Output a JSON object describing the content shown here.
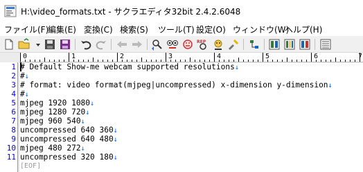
{
  "window": {
    "title": "H:\\video_formats.txt - サクラエディタ32bit 2.4.2.6048"
  },
  "menu": [
    "ファイル(F)",
    "編集(E)",
    "変換(C)",
    "検索(S)",
    "ツール(T)",
    "設定(O)",
    "ウィンドウ(W)",
    "ヘルプ(H)"
  ],
  "toolbar": {
    "icons": [
      "new-file-icon",
      "open-folder-icon",
      "open-dropdown-icon",
      "save-icon",
      "save-all-icon",
      "undo-icon",
      "redo-icon",
      "jump-back-icon",
      "jump-forward-icon",
      "search-prev-icon",
      "search-next-icon",
      "search-prev-red-icon",
      "grep-icon",
      "bookmark-icon",
      "replace-icon",
      "compare-icon",
      "macro-icon",
      "outline-icon",
      "settings-icon",
      "font-icon"
    ]
  },
  "ruler": {
    "labels": [
      "0",
      "1",
      "2",
      "3",
      "4",
      "5",
      "6",
      "7"
    ]
  },
  "editor": {
    "lines": [
      {
        "num": "1",
        "text": "# Default Show-me webcam supported resolutions",
        "newline": "↓"
      },
      {
        "num": "2",
        "text": "#",
        "newline": "↓"
      },
      {
        "num": "3",
        "text": "# format: video format(mjpeg|uncompressed) x-dimension y-dimension",
        "newline": "↓"
      },
      {
        "num": "4",
        "text": "#",
        "newline": "↓"
      },
      {
        "num": "5",
        "text": "mjpeg 1920 1080",
        "newline": "↓"
      },
      {
        "num": "6",
        "text": "mjpeg 1280 720",
        "newline": "↓"
      },
      {
        "num": "7",
        "text": "mjpeg 960 540",
        "newline": "↓"
      },
      {
        "num": "8",
        "text": "uncompressed 640 360",
        "newline": "↓"
      },
      {
        "num": "9",
        "text": "uncompressed 640 480",
        "newline": "↓"
      },
      {
        "num": "10",
        "text": "mjpeg 480 272",
        "newline": "↓"
      },
      {
        "num": "11",
        "text": "uncompressed 320 180",
        "newline": "↓"
      }
    ],
    "eof_label": "[EOF]"
  },
  "colors": {
    "line_number": "#0000ff",
    "newline_mark": "#0066ff",
    "toolbar_bg": "#f0f0f0"
  }
}
